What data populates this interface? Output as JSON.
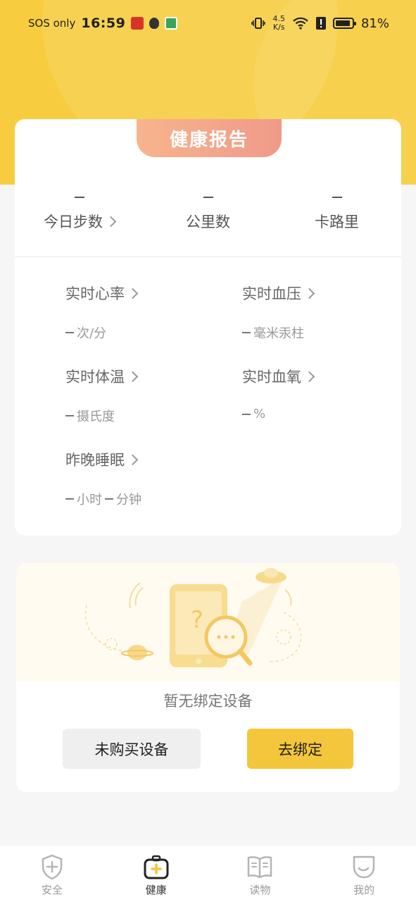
{
  "status_bar": {
    "carrier": "SOS only",
    "time": "16:59",
    "net_speed_top": "4.5",
    "net_speed_bottom": "K/s",
    "battery": "81%"
  },
  "report": {
    "title": "健康报告",
    "stats": [
      {
        "value": "",
        "label": "今日步数",
        "has_arrow": true
      },
      {
        "value": "",
        "label": "公里数",
        "has_arrow": false
      },
      {
        "value": "",
        "label": "卡路里",
        "has_arrow": false
      }
    ],
    "metrics": [
      {
        "title": "实时心率",
        "value": "次/分"
      },
      {
        "title": "实时血压",
        "value": "毫米汞柱"
      },
      {
        "title": "实时体温",
        "value": "摄氏度"
      },
      {
        "title": "实时血氧",
        "value": "%"
      },
      {
        "title": "昨晚睡眠",
        "value_parts": [
          "小时",
          "分钟"
        ]
      }
    ]
  },
  "device": {
    "empty_text": "暂无绑定设备",
    "buy_button": "未购买设备",
    "bind_button": "去绑定"
  },
  "tab_bar": {
    "items": [
      {
        "label": "安全",
        "icon": "shield-plus-icon"
      },
      {
        "label": "健康",
        "icon": "first-aid-kit-icon",
        "active": true
      },
      {
        "label": "读物",
        "icon": "open-book-icon"
      },
      {
        "label": "我的",
        "icon": "face-icon"
      }
    ]
  },
  "colors": {
    "accent": "#f4c63b",
    "header_bg": "#f7cd3f",
    "report_tab": "#f09a8a"
  }
}
